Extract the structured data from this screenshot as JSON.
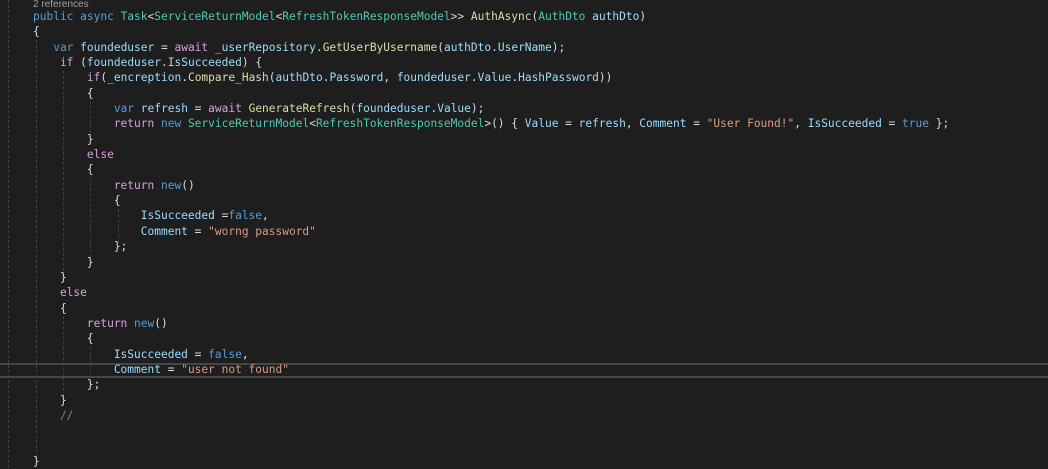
{
  "editor": {
    "codelens": "2 references",
    "lines": [
      [
        [
          "kw",
          "public async "
        ],
        [
          "ty",
          "Task"
        ],
        [
          "pl",
          "<"
        ],
        [
          "ty",
          "ServiceReturnModel"
        ],
        [
          "pl",
          "<"
        ],
        [
          "ty",
          "RefreshTokenResponseModel"
        ],
        [
          "pl",
          ">> "
        ],
        [
          "fn",
          "AuthAsync"
        ],
        [
          "pl",
          "("
        ],
        [
          "ty",
          "AuthDto"
        ],
        [
          "pl",
          " "
        ],
        [
          "id",
          "authDto"
        ],
        [
          "pl",
          ")"
        ]
      ],
      [
        [
          "pl",
          "{"
        ]
      ],
      [
        [
          "kw",
          "   var "
        ],
        [
          "id",
          "foundeduser"
        ],
        [
          "pl",
          " = "
        ],
        [
          "ctl",
          "await "
        ],
        [
          "id",
          "_userRepository"
        ],
        [
          "pl",
          "."
        ],
        [
          "fn",
          "GetUserByUsername"
        ],
        [
          "pl",
          "("
        ],
        [
          "id",
          "authDto"
        ],
        [
          "pl",
          "."
        ],
        [
          "id",
          "UserName"
        ],
        [
          "pl",
          ");"
        ]
      ],
      [
        [
          "ctl",
          "    if "
        ],
        [
          "pl",
          "("
        ],
        [
          "id",
          "foundeduser"
        ],
        [
          "pl",
          "."
        ],
        [
          "id",
          "IsSucceeded"
        ],
        [
          "pl",
          ") {"
        ]
      ],
      [
        [
          "ctl",
          "        if"
        ],
        [
          "pl",
          "("
        ],
        [
          "id",
          "_encreption"
        ],
        [
          "pl",
          "."
        ],
        [
          "fn",
          "Compare_Hash"
        ],
        [
          "pl",
          "("
        ],
        [
          "id",
          "authDto"
        ],
        [
          "pl",
          "."
        ],
        [
          "id",
          "Password"
        ],
        [
          "pl",
          ", "
        ],
        [
          "id",
          "foundeduser"
        ],
        [
          "pl",
          "."
        ],
        [
          "id",
          "Value"
        ],
        [
          "pl",
          "."
        ],
        [
          "id",
          "HashPassword"
        ],
        [
          "pl",
          "))"
        ]
      ],
      [
        [
          "pl",
          "        {"
        ]
      ],
      [
        [
          "kw",
          "            var "
        ],
        [
          "id",
          "refresh"
        ],
        [
          "pl",
          " = "
        ],
        [
          "ctl",
          "await "
        ],
        [
          "fn",
          "GenerateRefresh"
        ],
        [
          "pl",
          "("
        ],
        [
          "id",
          "foundeduser"
        ],
        [
          "pl",
          "."
        ],
        [
          "id",
          "Value"
        ],
        [
          "pl",
          ");"
        ]
      ],
      [
        [
          "ctl",
          "            return "
        ],
        [
          "kw",
          "new "
        ],
        [
          "ty",
          "ServiceReturnModel"
        ],
        [
          "pl",
          "<"
        ],
        [
          "ty",
          "RefreshTokenResponseModel"
        ],
        [
          "pl",
          ">() { "
        ],
        [
          "id",
          "Value"
        ],
        [
          "pl",
          " = "
        ],
        [
          "id",
          "refresh"
        ],
        [
          "pl",
          ", "
        ],
        [
          "id",
          "Comment"
        ],
        [
          "pl",
          " = "
        ],
        [
          "str",
          "\"User Found!\""
        ],
        [
          "pl",
          ", "
        ],
        [
          "id",
          "IsSucceeded"
        ],
        [
          "pl",
          " = "
        ],
        [
          "kw",
          "true"
        ],
        [
          "pl",
          " };"
        ]
      ],
      [
        [
          "pl",
          "        }"
        ]
      ],
      [
        [
          "ctl",
          "        else"
        ]
      ],
      [
        [
          "pl",
          "        {"
        ]
      ],
      [
        [
          "ctl",
          "            return "
        ],
        [
          "kw",
          "new"
        ],
        [
          "pl",
          "()"
        ]
      ],
      [
        [
          "pl",
          "            {"
        ]
      ],
      [
        [
          "id",
          "                IsSucceeded"
        ],
        [
          "pl",
          " ="
        ],
        [
          "kw",
          "false"
        ],
        [
          "pl",
          ","
        ]
      ],
      [
        [
          "id",
          "                Comment"
        ],
        [
          "pl",
          " = "
        ],
        [
          "str",
          "\"worng password\""
        ]
      ],
      [
        [
          "pl",
          "            };"
        ]
      ],
      [
        [
          "pl",
          "        }"
        ]
      ],
      [
        [
          "pl",
          "    }"
        ]
      ],
      [
        [
          "ctl",
          "    else"
        ]
      ],
      [
        [
          "pl",
          "    {"
        ]
      ],
      [
        [
          "ctl",
          "        return "
        ],
        [
          "kw",
          "new"
        ],
        [
          "pl",
          "()"
        ]
      ],
      [
        [
          "pl",
          "        {"
        ]
      ],
      [
        [
          "id",
          "            IsSucceeded"
        ],
        [
          "pl",
          " = "
        ],
        [
          "kw",
          "false"
        ],
        [
          "pl",
          ","
        ]
      ],
      [
        [
          "id",
          "            Comment"
        ],
        [
          "pl",
          " = "
        ],
        [
          "str",
          "\"user not found\""
        ]
      ],
      [
        [
          "pl",
          "        };"
        ]
      ],
      [
        [
          "pl",
          "    }"
        ]
      ],
      [
        [
          "cm",
          "    //"
        ]
      ],
      [],
      [],
      [
        [
          "pl",
          "}"
        ]
      ]
    ]
  },
  "colors": {
    "background": "#1e1e1e",
    "keyword": "#569cd6",
    "control": "#d8a0df",
    "type": "#4ec9b0",
    "method": "#dcdcaa",
    "identifier": "#9cdcfe",
    "string": "#d69d85",
    "comment": "#57a64a"
  }
}
